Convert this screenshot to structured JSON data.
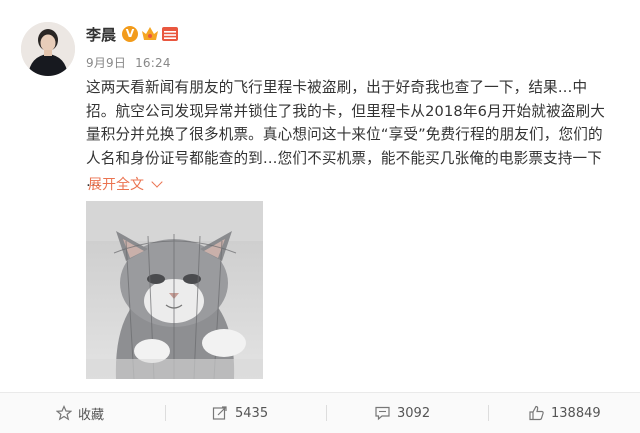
{
  "post": {
    "author": {
      "name": "李晨",
      "verified_icon": "verified-v-icon",
      "verified_label": "V",
      "member_icon": "vip-crown-icon",
      "level_icon": "level-badge-icon"
    },
    "meta": {
      "date": "9月9日",
      "time": "16:24"
    },
    "text": "这两天看新闻有朋友的飞行里程卡被盗刷，出于好奇我也查了一下，结果…中招。航空公司发现异常并锁住了我的卡，但里程卡从2018年6月开始就被盗刷大量积分并兑换了很多机票。真心想问这十来位“享受”免费行程的朋友们，您们的人名和身份证号都能查的到…您们不买机票，能不能买几张俺的电影票支持一下 …",
    "expand_label": "展开全文",
    "image_icon": "cat-photo"
  },
  "actions": {
    "favorite_label": "收藏",
    "repost_count": "5435",
    "comment_count": "3092",
    "like_count": "138849"
  },
  "colors": {
    "link": "#eb7350",
    "verified": "#f29b1b",
    "text": "#333333",
    "meta": "#888888"
  }
}
